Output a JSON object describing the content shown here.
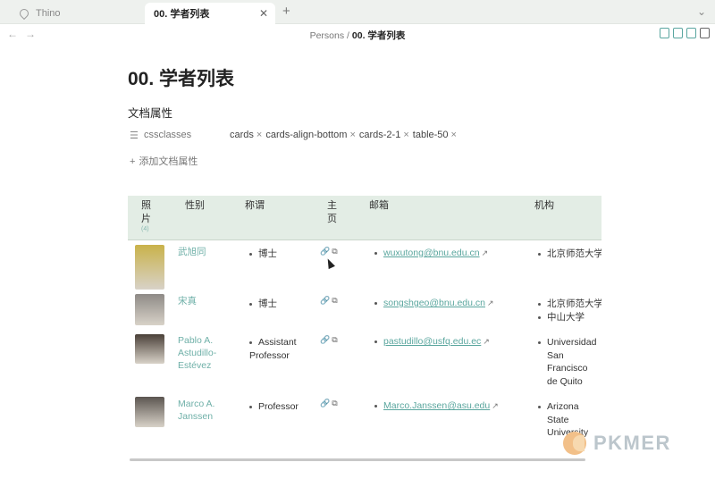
{
  "tabs": [
    {
      "label": "Thino",
      "active": false
    },
    {
      "label": "00. 学者列表",
      "active": true
    }
  ],
  "breadcrumb": {
    "parent": "Persons",
    "separator": "/",
    "current": "00. 学者列表"
  },
  "page": {
    "title": "00. 学者列表"
  },
  "properties": {
    "heading": "文档属性",
    "rows": [
      {
        "name": "cssclasses",
        "values": [
          "cards",
          "cards-align-bottom",
          "cards-2-1",
          "table-50"
        ]
      }
    ],
    "add_label": "添加文档属性"
  },
  "table": {
    "headers": {
      "photo": "照\n片",
      "photo_count": "(4)",
      "gender": "性别",
      "title": "称谓",
      "homepage": "主\n页",
      "email": "邮箱",
      "org": "机构"
    },
    "rows": [
      {
        "name": "武旭同",
        "title": "博士",
        "email": "wuxutong@bnu.edu.cn",
        "orgs": [
          "北京师范大学"
        ],
        "photo_color": "#c9b24a"
      },
      {
        "name": "宋真",
        "title": "博士",
        "email": "songshgeo@bnu.edu.cn",
        "orgs": [
          "北京师范大学",
          "中山大学"
        ],
        "photo_color": "#8e8a86"
      },
      {
        "name": "Pablo A. Astudillo-Estévez",
        "title": "Assistant Professor",
        "email": "pastudillo@usfq.edu.ec",
        "orgs": [
          "Universidad San Francisco de Quito"
        ],
        "photo_color": "#4a4038"
      },
      {
        "name": "Marco A. Janssen",
        "title": "Professor",
        "email": "Marco.Janssen@asu.edu",
        "orgs": [
          "Arizona State University"
        ],
        "photo_color": "#5b5550"
      }
    ]
  },
  "watermark": {
    "text": "PKMER"
  },
  "colors": {
    "accent": "#6fb0a8",
    "header_bg": "#e3ede5"
  }
}
